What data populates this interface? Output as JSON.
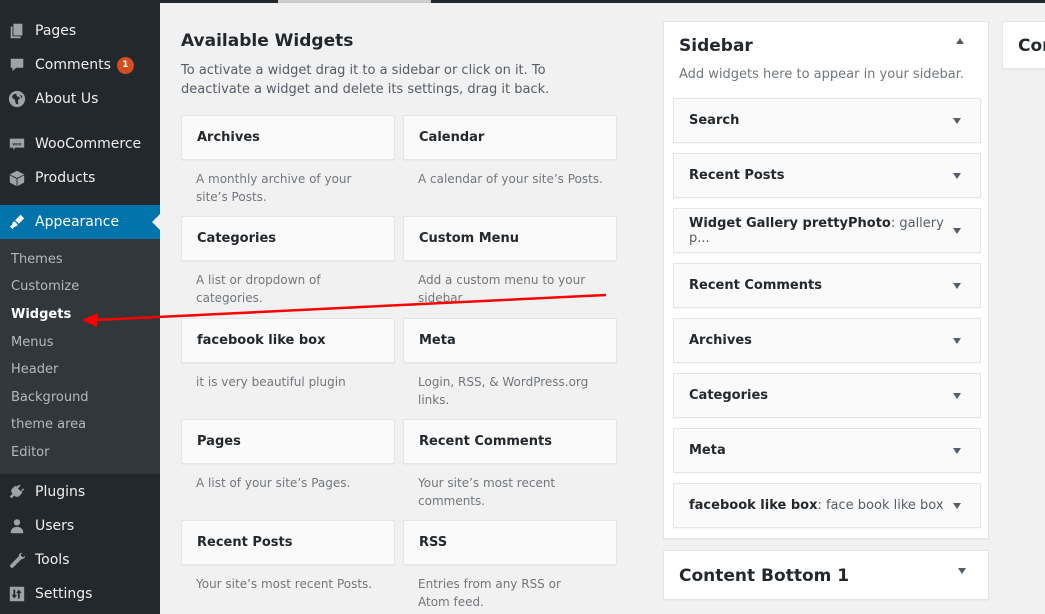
{
  "admin_menu": {
    "items": [
      {
        "label": "Pages",
        "icon": "pages-icon"
      },
      {
        "label": "Comments",
        "icon": "comments-icon",
        "badge": "1"
      },
      {
        "label": "About Us",
        "icon": "globe-icon"
      },
      {
        "label": "WooCommerce",
        "icon": "woocommerce-icon"
      },
      {
        "label": "Products",
        "icon": "products-icon"
      },
      {
        "label": "Appearance",
        "icon": "appearance-icon",
        "current": true
      },
      {
        "label": "Plugins",
        "icon": "plugins-icon"
      },
      {
        "label": "Users",
        "icon": "users-icon"
      },
      {
        "label": "Tools",
        "icon": "tools-icon"
      },
      {
        "label": "Settings",
        "icon": "settings-icon"
      }
    ],
    "appearance_submenu": [
      {
        "label": "Themes"
      },
      {
        "label": "Customize"
      },
      {
        "label": "Widgets",
        "current": true
      },
      {
        "label": "Menus"
      },
      {
        "label": "Header"
      },
      {
        "label": "Background"
      },
      {
        "label": "theme area"
      },
      {
        "label": "Editor"
      }
    ]
  },
  "available_widgets": {
    "title": "Available Widgets",
    "description": "To activate a widget drag it to a sidebar or click on it. To deactivate a widget and delete its settings, drag it back.",
    "widgets": [
      {
        "name": "Archives",
        "description": "A monthly archive of your site’s Posts."
      },
      {
        "name": "Calendar",
        "description": "A calendar of your site’s Posts."
      },
      {
        "name": "Categories",
        "description": "A list or dropdown of categories."
      },
      {
        "name": "Custom Menu",
        "description": "Add a custom menu to your sidebar."
      },
      {
        "name": "facebook like box",
        "description": "it is very beautiful plugin"
      },
      {
        "name": "Meta",
        "description": "Login, RSS, & WordPress.org links."
      },
      {
        "name": "Pages",
        "description": "A list of your site’s Pages."
      },
      {
        "name": "Recent Comments",
        "description": "Your site’s most recent comments."
      },
      {
        "name": "Recent Posts",
        "description": "Your site’s most recent Posts."
      },
      {
        "name": "RSS",
        "description": "Entries from any RSS or Atom feed."
      }
    ]
  },
  "sidebar_area": {
    "title": "Sidebar",
    "description": "Add widgets here to appear in your sidebar.",
    "widgets": [
      {
        "name": "Search",
        "subtitle": ""
      },
      {
        "name": "Recent Posts",
        "subtitle": ""
      },
      {
        "name": "Widget Gallery prettyPhoto",
        "subtitle": ": gallery p..."
      },
      {
        "name": "Recent Comments",
        "subtitle": ""
      },
      {
        "name": "Archives",
        "subtitle": ""
      },
      {
        "name": "Categories",
        "subtitle": ""
      },
      {
        "name": "Meta",
        "subtitle": ""
      },
      {
        "name": "facebook like box",
        "subtitle": ": face book like box"
      }
    ]
  },
  "other_areas": {
    "content_bottom_title": "Content Bottom 1",
    "next_area_title_partial": "Cor"
  },
  "colors": {
    "menu_bg": "#23282d",
    "submenu_bg": "#32373c",
    "accent": "#0073aa",
    "badge": "#d54e21",
    "annotation_arrow": "#ff0000"
  }
}
